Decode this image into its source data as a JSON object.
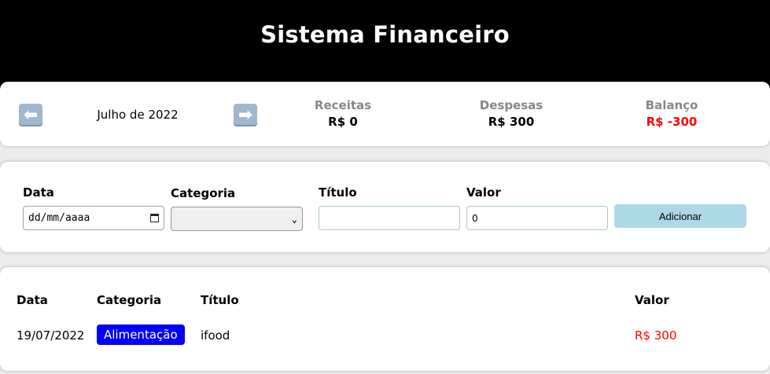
{
  "header": {
    "title": "Sistema Financeiro"
  },
  "info": {
    "month_label": "Julho de 2022",
    "prev_icon": "⬅",
    "next_icon": "➡",
    "income": {
      "label": "Receitas",
      "value": "R$ 0"
    },
    "expense": {
      "label": "Despesas",
      "value": "R$ 300"
    },
    "balance": {
      "label": "Balanço",
      "value": "R$ -300",
      "color": "#ff0000"
    }
  },
  "form": {
    "date": {
      "label": "Data",
      "placeholder": "dd/mm/aaaa"
    },
    "category": {
      "label": "Categoria",
      "value": ""
    },
    "title": {
      "label": "Título",
      "value": ""
    },
    "value": {
      "label": "Valor",
      "value": "0"
    },
    "add_button": "Adicionar"
  },
  "table": {
    "headers": {
      "date": "Data",
      "category": "Categoria",
      "title": "Título",
      "value": "Valor"
    },
    "rows": [
      {
        "date": "19/07/2022",
        "category": "Alimentação",
        "category_color": "#0000ff",
        "title": "ifood",
        "value": "R$ 300",
        "value_color": "#ff0000"
      }
    ]
  }
}
